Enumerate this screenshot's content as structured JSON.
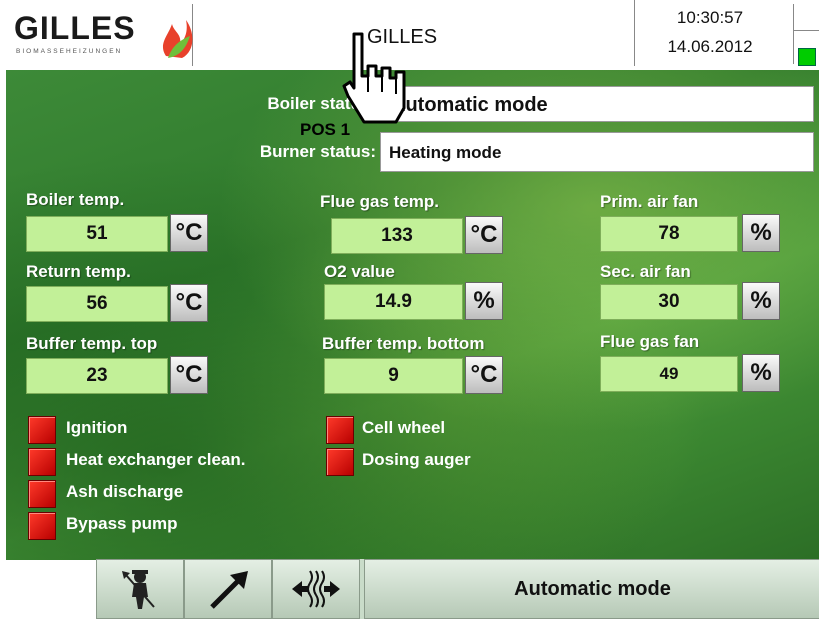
{
  "header": {
    "logo_text": "GILLES",
    "logo_sub": "BIOMASSEHEIZUNGEN",
    "title": "GILLES",
    "time": "10:30:57",
    "date": "14.06.2012"
  },
  "status": {
    "boiler_label": "Boiler status:",
    "boiler_value": "Automatic mode",
    "burner_label": "Burner status:",
    "burner_value": "Heating mode"
  },
  "overlay": {
    "pos_label": "POS 1"
  },
  "measurements": {
    "boiler_temp": {
      "label": "Boiler temp.",
      "value": "51",
      "unit": "°C"
    },
    "return_temp": {
      "label": "Return temp.",
      "value": "56",
      "unit": "°C"
    },
    "buffer_top": {
      "label": "Buffer temp. top",
      "value": "23",
      "unit": "°C"
    },
    "flue_gas_temp": {
      "label": "Flue gas temp.",
      "value": "133",
      "unit": "°C"
    },
    "o2_value": {
      "label": "O2 value",
      "value": "14.9",
      "unit": "%"
    },
    "buffer_bottom": {
      "label": "Buffer temp. bottom",
      "value": "9",
      "unit": "°C"
    },
    "prim_air_fan": {
      "label": "Prim. air fan",
      "value": "78",
      "unit": "%"
    },
    "sec_air_fan": {
      "label": "Sec. air fan",
      "value": "30",
      "unit": "%"
    },
    "flue_gas_fan": {
      "label": "Flue gas fan",
      "value": "49",
      "unit": "%"
    }
  },
  "indicators": {
    "ignition": "Ignition",
    "heat_exchanger": "Heat exchanger clean.",
    "ash_discharge": "Ash discharge",
    "bypass_pump": "Bypass pump",
    "cell_wheel": "Cell wheel",
    "dosing_auger": "Dosing auger",
    "lamp_color": "#e31b12"
  },
  "bottom": {
    "mode_text": "Automatic mode",
    "icons": [
      "chimney-sweep-icon",
      "arrow-up-right-icon",
      "heat-exchange-icon"
    ]
  },
  "colors": {
    "value_bg": "#c2f098",
    "signal_green": "#00cc00"
  }
}
